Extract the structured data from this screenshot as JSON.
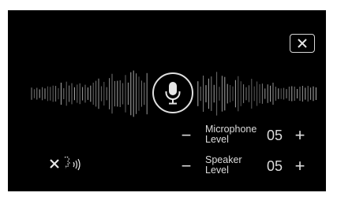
{
  "close_button": {
    "icon": "close-icon"
  },
  "mic_button": {
    "icon": "microphone-icon",
    "accent": "#e0e0e0"
  },
  "microphone_level": {
    "label_line1": "Microphone",
    "label_line2": "Level",
    "value": "05",
    "minus": "−",
    "plus": "+"
  },
  "speaker_level": {
    "label_line1": "Speaker",
    "label_line2": "Level",
    "value": "05",
    "minus": "−",
    "plus": "+"
  },
  "voice_mute": {
    "icon": "voice-mute-icon"
  },
  "colors": {
    "background": "#000000",
    "foreground": "#dcdcdc"
  }
}
